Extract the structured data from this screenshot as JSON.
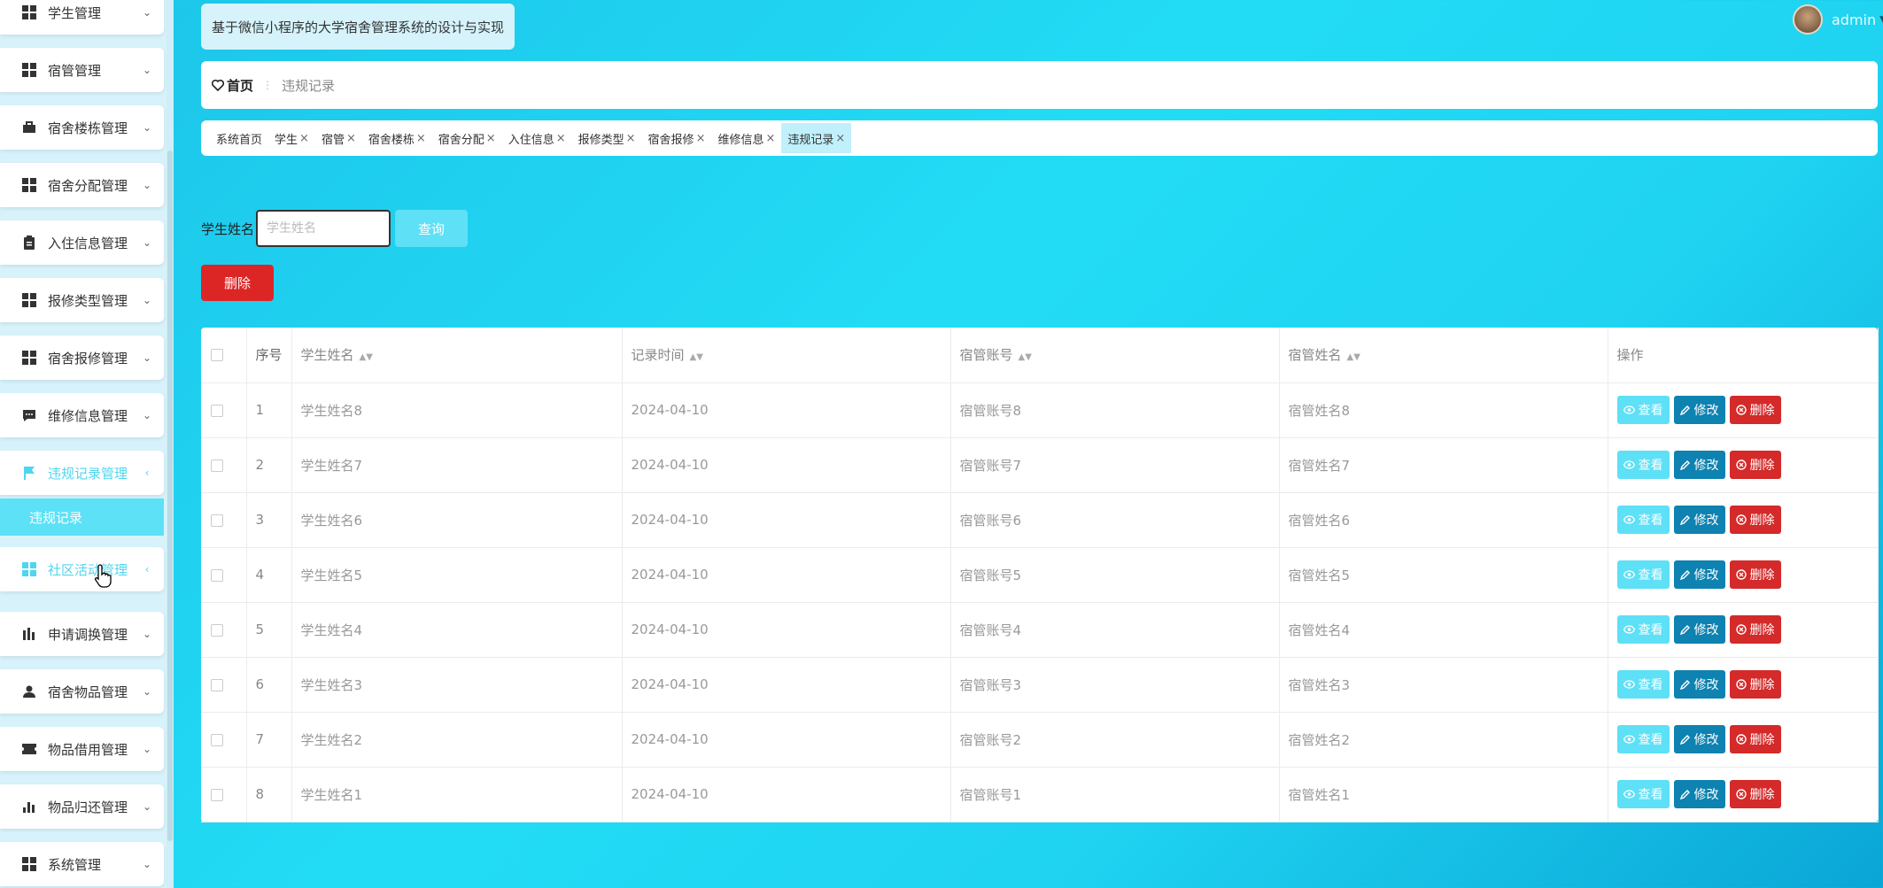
{
  "app_title": "基于微信小程序的大学宿舍管理系统的设计与实现",
  "user": {
    "name": "admin"
  },
  "sidebar": {
    "items": [
      {
        "label": "学生管理",
        "icon": "grid-icon"
      },
      {
        "label": "宿管管理",
        "icon": "grid-icon"
      },
      {
        "label": "宿舍楼栋管理",
        "icon": "briefcase-icon"
      },
      {
        "label": "宿舍分配管理",
        "icon": "grid-icon"
      },
      {
        "label": "入住信息管理",
        "icon": "clipboard-icon"
      },
      {
        "label": "报修类型管理",
        "icon": "grid-icon"
      },
      {
        "label": "宿舍报修管理",
        "icon": "grid-icon"
      },
      {
        "label": "维修信息管理",
        "icon": "chat-icon"
      },
      {
        "label": "违规记录管理",
        "icon": "flag-icon"
      },
      {
        "label": "社区活动管理",
        "icon": "grid-icon"
      },
      {
        "label": "申请调换管理",
        "icon": "bar-chart-icon"
      },
      {
        "label": "宿舍物品管理",
        "icon": "user-icon"
      },
      {
        "label": "物品借用管理",
        "icon": "ticket-icon"
      },
      {
        "label": "物品归还管理",
        "icon": "bar-chart-icon"
      },
      {
        "label": "系统管理",
        "icon": "grid-icon"
      }
    ],
    "sub_item": "违规记录"
  },
  "breadcrumb": {
    "home": "首页",
    "current": "违规记录"
  },
  "tabs": [
    {
      "label": "系统首页",
      "closable": false
    },
    {
      "label": "学生",
      "closable": true
    },
    {
      "label": "宿管",
      "closable": true
    },
    {
      "label": "宿舍楼栋",
      "closable": true
    },
    {
      "label": "宿舍分配",
      "closable": true
    },
    {
      "label": "入住信息",
      "closable": true
    },
    {
      "label": "报修类型",
      "closable": true
    },
    {
      "label": "宿舍报修",
      "closable": true
    },
    {
      "label": "维修信息",
      "closable": true
    },
    {
      "label": "违规记录",
      "closable": true,
      "active": true
    }
  ],
  "search": {
    "label": "学生姓名",
    "placeholder": "学生姓名",
    "button": "查询"
  },
  "delete_button": "删除",
  "table": {
    "headers": {
      "seq": "序号",
      "student_name": "学生姓名",
      "record_time": "记录时间",
      "manager_account": "宿管账号",
      "manager_name": "宿管姓名",
      "actions": "操作"
    },
    "action_labels": {
      "view": "查看",
      "edit": "修改",
      "delete": "删除"
    },
    "rows": [
      {
        "seq": "1",
        "student_name": "学生姓名8",
        "record_time": "2024-04-10",
        "manager_account": "宿管账号8",
        "manager_name": "宿管姓名8"
      },
      {
        "seq": "2",
        "student_name": "学生姓名7",
        "record_time": "2024-04-10",
        "manager_account": "宿管账号7",
        "manager_name": "宿管姓名7"
      },
      {
        "seq": "3",
        "student_name": "学生姓名6",
        "record_time": "2024-04-10",
        "manager_account": "宿管账号6",
        "manager_name": "宿管姓名6"
      },
      {
        "seq": "4",
        "student_name": "学生姓名5",
        "record_time": "2024-04-10",
        "manager_account": "宿管账号5",
        "manager_name": "宿管姓名5"
      },
      {
        "seq": "5",
        "student_name": "学生姓名4",
        "record_time": "2024-04-10",
        "manager_account": "宿管账号4",
        "manager_name": "宿管姓名4"
      },
      {
        "seq": "6",
        "student_name": "学生姓名3",
        "record_time": "2024-04-10",
        "manager_account": "宿管账号3",
        "manager_name": "宿管姓名3"
      },
      {
        "seq": "7",
        "student_name": "学生姓名2",
        "record_time": "2024-04-10",
        "manager_account": "宿管账号2",
        "manager_name": "宿管姓名2"
      },
      {
        "seq": "8",
        "student_name": "学生姓名1",
        "record_time": "2024-04-10",
        "manager_account": "宿管账号1",
        "manager_name": "宿管姓名1"
      }
    ]
  },
  "colors": {
    "accent": "#5ee0f6",
    "edit": "#0e82b0",
    "danger": "#d42a2a",
    "background": "#1fd3f1"
  }
}
